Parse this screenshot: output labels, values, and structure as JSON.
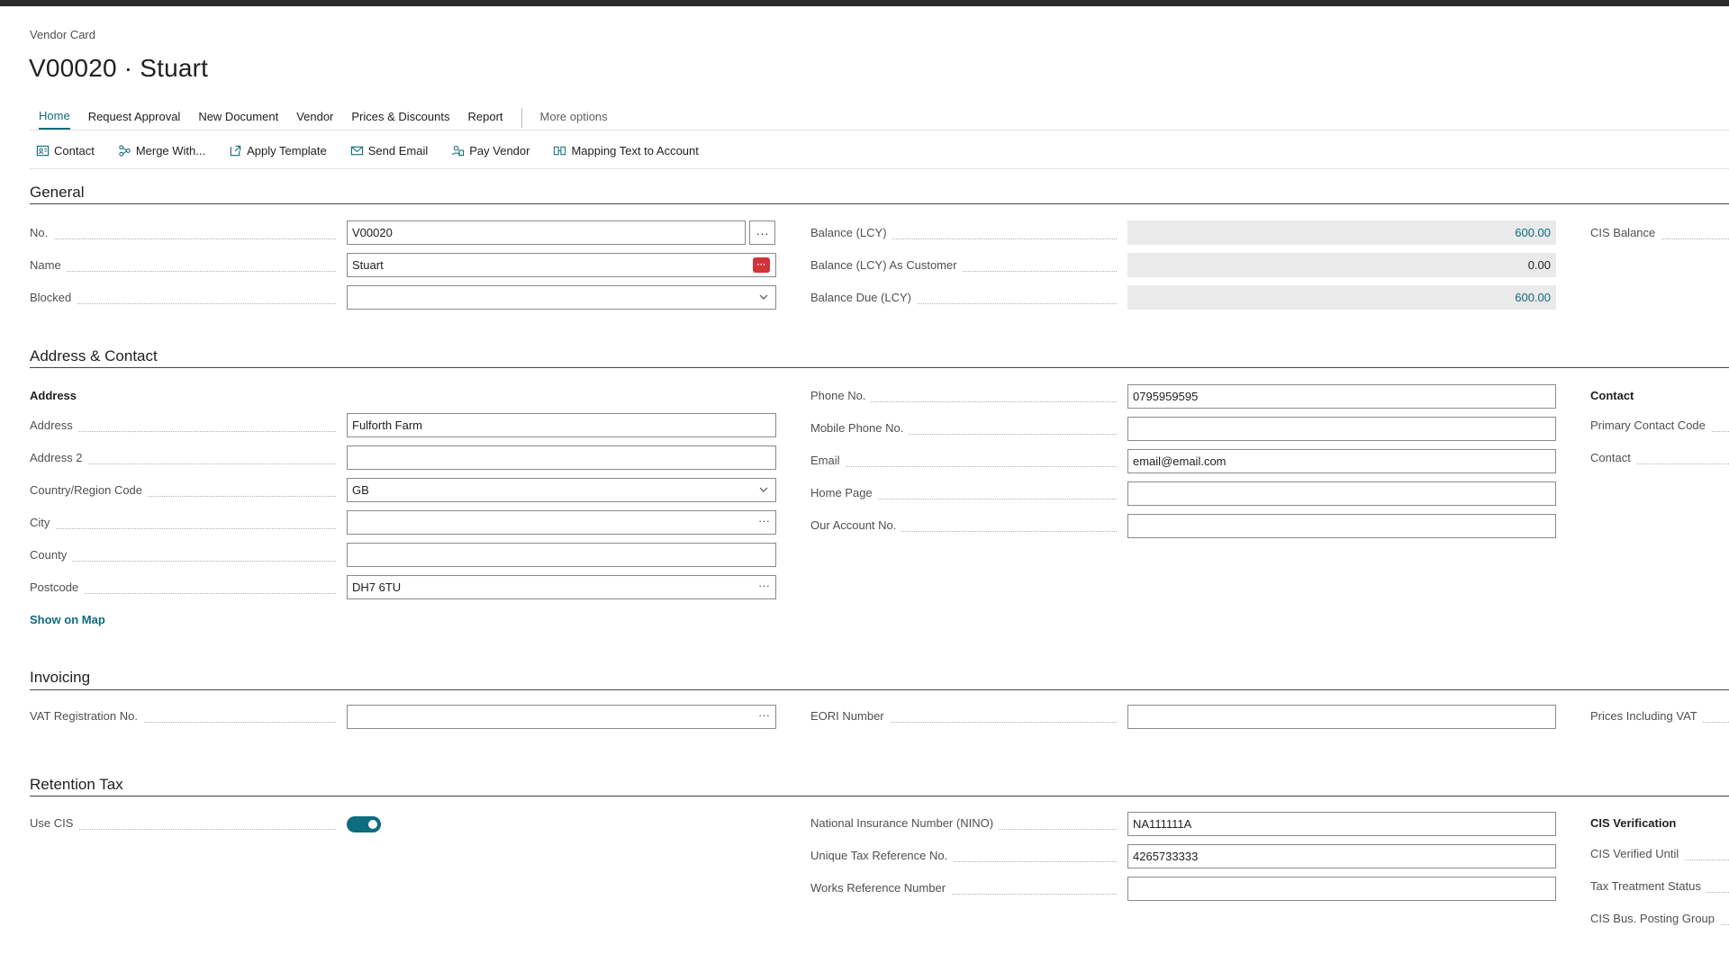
{
  "page": {
    "breadcrumb": "Vendor Card",
    "title": "V00020 · Stuart"
  },
  "tabs": [
    {
      "label": "Home",
      "active": true
    },
    {
      "label": "Request Approval"
    },
    {
      "label": "New Document"
    },
    {
      "label": "Vendor"
    },
    {
      "label": "Prices & Discounts"
    },
    {
      "label": "Report"
    },
    {
      "label": "More options"
    }
  ],
  "actions": [
    {
      "label": "Contact",
      "icon": "contact-card-icon"
    },
    {
      "label": "Merge With...",
      "icon": "merge-icon"
    },
    {
      "label": "Apply Template",
      "icon": "apply-template-icon"
    },
    {
      "label": "Send Email",
      "icon": "email-icon"
    },
    {
      "label": "Pay Vendor",
      "icon": "pay-vendor-icon"
    },
    {
      "label": "Mapping Text to Account",
      "icon": "mapping-icon"
    }
  ],
  "sections": {
    "general": {
      "title": "General",
      "no_label": "No.",
      "no_value": "V00020",
      "name_label": "Name",
      "name_value": "Stuart",
      "blocked_label": "Blocked",
      "blocked_value": "",
      "balance_label": "Balance (LCY)",
      "balance_value": "600.00",
      "balance_cust_label": "Balance (LCY) As Customer",
      "balance_cust_value": "0.00",
      "balance_due_label": "Balance Due (LCY)",
      "balance_due_value": "600.00",
      "cis_balance_label": "CIS Balance"
    },
    "address": {
      "title": "Address & Contact",
      "address_head": "Address",
      "address_label": "Address",
      "address_value": "Fulforth Farm",
      "address2_label": "Address 2",
      "address2_value": "",
      "country_label": "Country/Region Code",
      "country_value": "GB",
      "city_label": "City",
      "city_value": "",
      "county_label": "County",
      "county_value": "",
      "postcode_label": "Postcode",
      "postcode_value": "DH7 6TU",
      "show_map": "Show on Map",
      "phone_label": "Phone No.",
      "phone_value": "0795959595",
      "mobile_label": "Mobile Phone No.",
      "mobile_value": "",
      "email_label": "Email",
      "email_value": "email@email.com",
      "homepage_label": "Home Page",
      "homepage_value": "",
      "account_label": "Our Account No.",
      "account_value": "",
      "contact_head": "Contact",
      "primary_contact_label": "Primary Contact Code",
      "contact_label": "Contact"
    },
    "invoicing": {
      "title": "Invoicing",
      "vat_label": "VAT Registration No.",
      "vat_value": "",
      "eori_label": "EORI Number",
      "eori_value": "",
      "prices_vat_label": "Prices Including VAT"
    },
    "retention": {
      "title": "Retention Tax",
      "use_cis_label": "Use CIS",
      "use_cis_on": true,
      "nino_label": "National Insurance Number (NINO)",
      "nino_value": "NA111111A",
      "utr_label": "Unique Tax Reference No.",
      "utr_value": "4265733333",
      "works_label": "Works Reference Number",
      "works_value": "",
      "cis_verification_head": "CIS Verification",
      "cis_verified_label": "CIS Verified Until",
      "tax_treatment_label": "Tax Treatment Status",
      "cis_bus_label": "CIS Bus. Posting Group"
    }
  },
  "colors": {
    "accent": "#0f6b80",
    "error_badge": "#d13438"
  }
}
